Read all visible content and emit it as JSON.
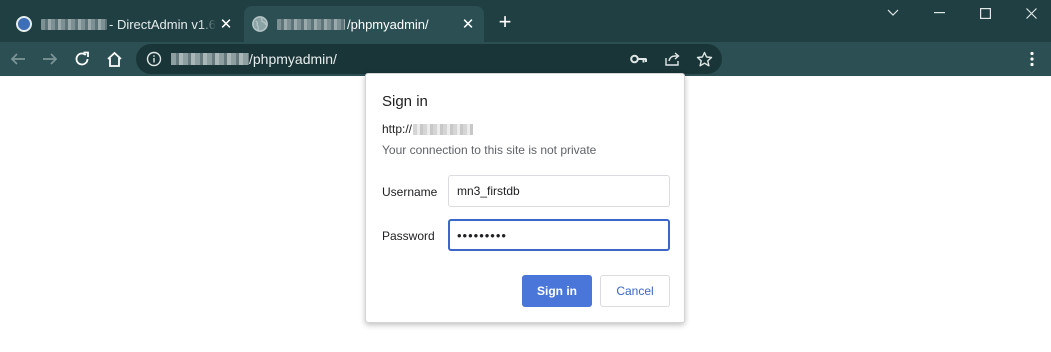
{
  "tabs": [
    {
      "title": "- DirectAdmin v1.64",
      "close": "✕"
    },
    {
      "title": "/phpmyadmin/",
      "close": "✕"
    }
  ],
  "newtab_label": "+",
  "address_bar": {
    "path": "/phpmyadmin/"
  },
  "dialog": {
    "title": "Sign in",
    "origin": "http://",
    "warning": "Your connection to this site is not private",
    "username_label": "Username",
    "username_value": "mn3_firstdb",
    "password_label": "Password",
    "password_value": "•••••••••",
    "signin_label": "Sign in",
    "cancel_label": "Cancel"
  },
  "colors": {
    "tabstrip": "#1f3f42",
    "toolbar": "#2b4f52",
    "primary_button": "#4a76d9",
    "focus_ring": "#3c67c8"
  },
  "icons": [
    "globe-icon",
    "close-icon",
    "plus-icon",
    "chevron-down-icon",
    "minimize-icon",
    "maximize-icon",
    "window-close-icon",
    "back-arrow-icon",
    "forward-arrow-icon",
    "reload-icon",
    "home-icon",
    "info-icon",
    "key-icon",
    "share-icon",
    "star-icon",
    "more-vertical-icon"
  ]
}
